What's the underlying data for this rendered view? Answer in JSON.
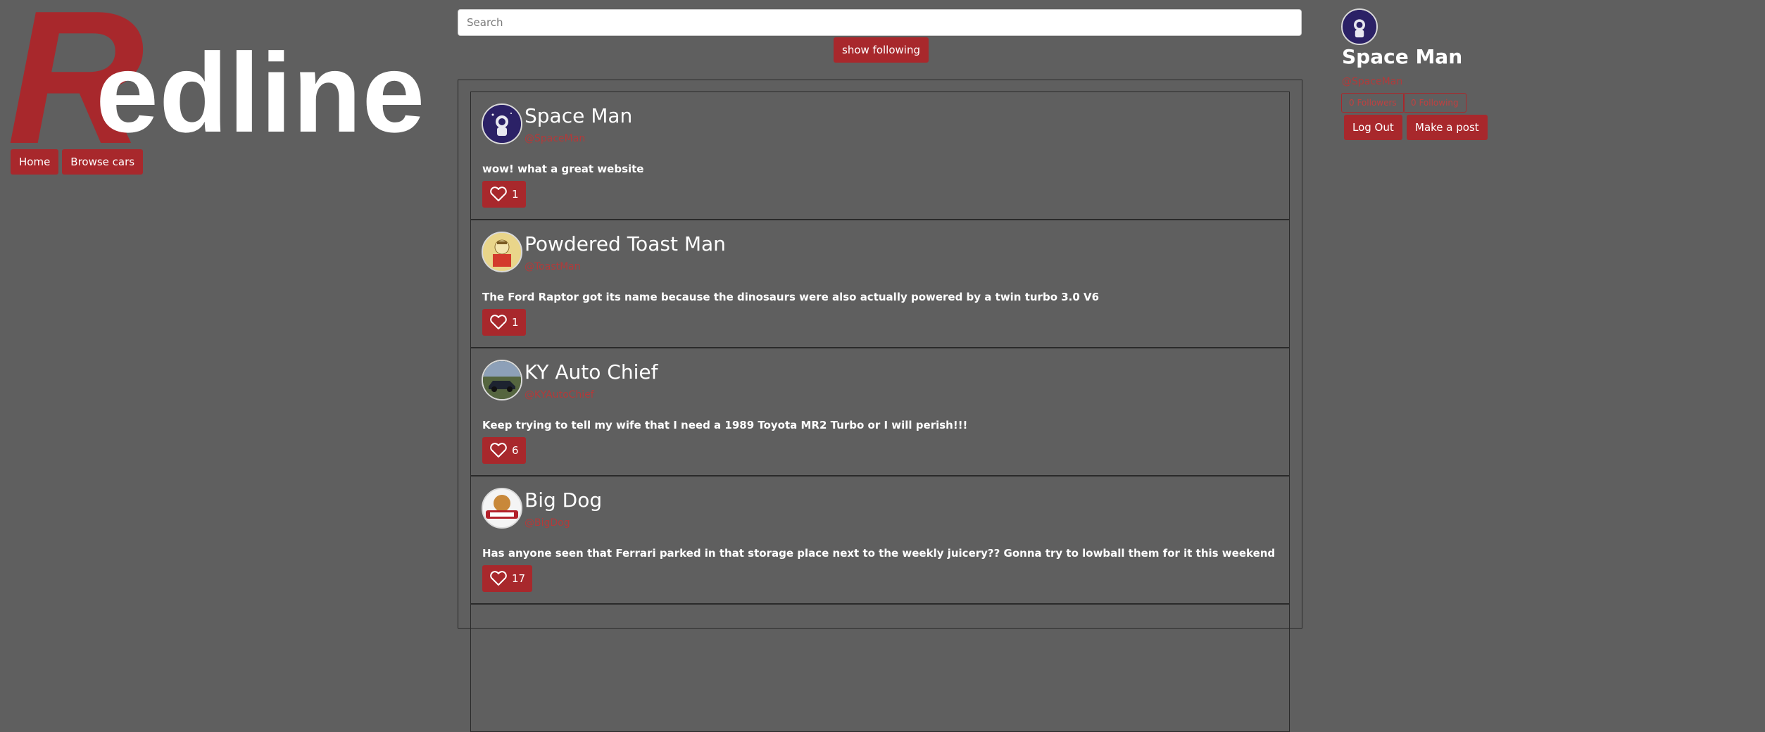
{
  "brand": {
    "letter": "R",
    "rest": "edline"
  },
  "nav": {
    "home": "Home",
    "browse": "Browse cars"
  },
  "search": {
    "placeholder": "Search",
    "value": ""
  },
  "show_following": "show following",
  "posts": [
    {
      "name": "Space Man",
      "handle": "@SpaceMan",
      "text": "wow! what a great website",
      "likes": "1",
      "avatar_icon": "astronaut-icon"
    },
    {
      "name": "Powdered Toast Man",
      "handle": "@ToastMan",
      "text": "The Ford Raptor got its name because the dinosaurs were also actually powered by a twin turbo 3.0 V6",
      "likes": "1",
      "avatar_icon": "toast-man-icon"
    },
    {
      "name": "KY Auto Chief",
      "handle": "@KYAutoChief",
      "text": "Keep trying to tell my wife that I need a 1989 Toyota MR2 Turbo or I will perish!!!",
      "likes": "6",
      "avatar_icon": "car-icon"
    },
    {
      "name": "Big Dog",
      "handle": "@BigDog",
      "text": "Has anyone seen that Ferrari parked in that storage place next to the weekly juicery?? Gonna try to lowball them for it this weekend",
      "likes": "17",
      "avatar_icon": "big-dawg-icon"
    }
  ],
  "profile": {
    "name": "Space Man",
    "handle": "@SpaceMan",
    "followers": "0 Followers",
    "following": "0 Following",
    "logout": "Log Out",
    "make_post": "Make a post"
  },
  "colors": {
    "accent": "#a8282c",
    "background": "#5f5f5f",
    "text": "#ffffff"
  }
}
